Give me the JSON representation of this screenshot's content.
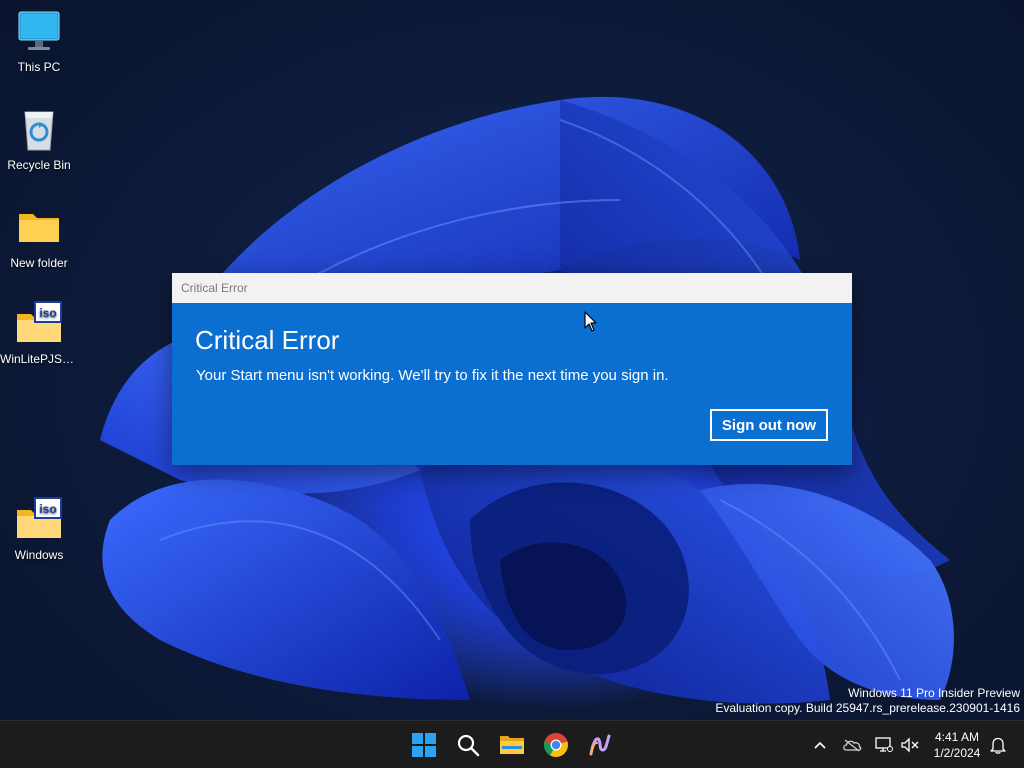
{
  "desktop": {
    "icons": [
      {
        "label": "This PC",
        "icon": "monitor-icon"
      },
      {
        "label": "Recycle Bin",
        "icon": "recycle-bin-icon"
      },
      {
        "label": "New folder",
        "icon": "folder-icon"
      },
      {
        "label": "WinLitePJSK...",
        "icon": "iso-file-icon"
      },
      {
        "label": "Windows",
        "icon": "iso-file-icon"
      }
    ]
  },
  "dialog": {
    "window_title": "Critical Error",
    "heading": "Critical Error",
    "message": "Your Start menu isn't working. We'll try to fix it the next time you sign in.",
    "button_label": "Sign out now",
    "accent_color": "#0a6fd1"
  },
  "watermark": {
    "line1": "Windows 11 Pro Insider Preview",
    "line2": "Evaluation copy. Build 25947.rs_prerelease.230901-1416"
  },
  "taskbar": {
    "pinned": [
      "start-icon",
      "search-icon",
      "file-explorer-icon",
      "chrome-icon",
      "app-icon"
    ],
    "tray": [
      "chevron-up-icon",
      "onedrive-icon",
      "network-icon",
      "volume-muted-icon",
      "notification-bell-icon"
    ],
    "clock": {
      "time": "4:41 AM",
      "date": "1/2/2024"
    }
  }
}
